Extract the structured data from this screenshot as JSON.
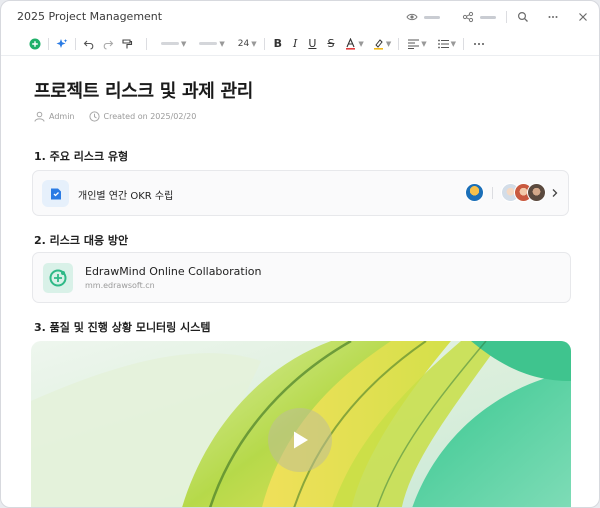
{
  "window": {
    "title": "2025 Project Management"
  },
  "toolbar": {
    "font_size": "24"
  },
  "document": {
    "title": "프로젝트 리스크 및 과제 관리",
    "author": "Admin",
    "created": "Created on 2025/02/20"
  },
  "sections": [
    {
      "heading": "1. 주요 리스크 유형"
    },
    {
      "heading": "2. 리스크 대응 방안"
    },
    {
      "heading": "3. 품질 및 진행 상황 모니터링 시스템"
    }
  ],
  "okr_card": {
    "title": "개인별 연간 OKR 수립",
    "icon": "document-icon"
  },
  "link_card": {
    "title": "EdrawMind Online Collaboration",
    "url": "mm.edrawsoft.cn",
    "icon": "edrawmind-logo"
  },
  "video": {
    "icon": "play-icon"
  },
  "colors": {
    "accent": "#2a7be4",
    "green": "#1fb069",
    "edraw": "#2fb987"
  }
}
